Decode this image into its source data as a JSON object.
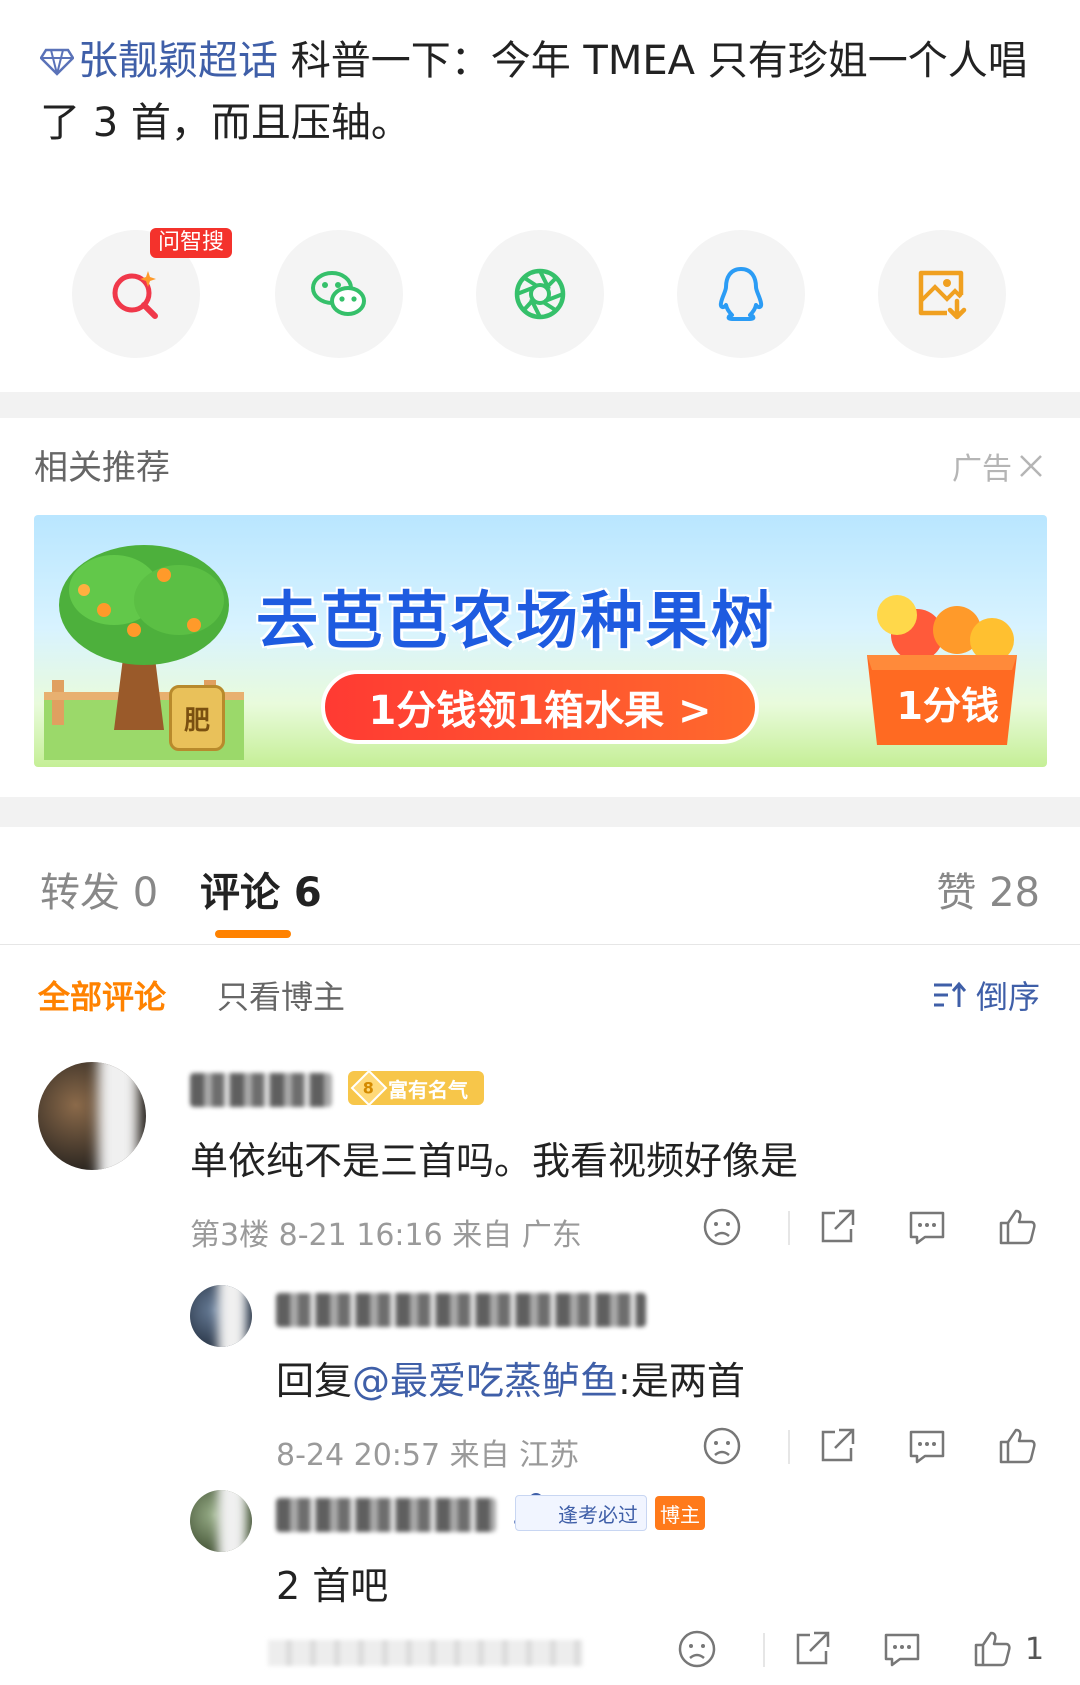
{
  "post": {
    "topic": "张靓颖超话",
    "text": " 科普一下：今年 TMEA 只有珍姐一个人唱了 3 首，而且压轴。"
  },
  "share": {
    "ask_tag": "问智搜",
    "buttons": [
      {
        "name": "ask-search",
        "icon": "search-spark-icon",
        "color": "#f0384a"
      },
      {
        "name": "wechat",
        "icon": "wechat-icon",
        "color": "#35c06a"
      },
      {
        "name": "moments",
        "icon": "aperture-icon",
        "color": "#35c06a"
      },
      {
        "name": "qq",
        "icon": "qq-penguin-icon",
        "color": "#2b9cf5"
      },
      {
        "name": "save-image",
        "icon": "image-download-icon",
        "color": "#f0a020"
      }
    ]
  },
  "recommend": {
    "heading": "相关推荐",
    "ad_label": "广告",
    "banner": {
      "title": "去芭芭农场种果树",
      "cta": "1分钱领1箱水果 >",
      "box_label": "1分钱",
      "fertilizer": "肥"
    }
  },
  "tabs": {
    "forward": "转发 0",
    "comments": "评论 6",
    "likes": "赞 28"
  },
  "filter": {
    "all": "全部评论",
    "op_only": "只看博主",
    "sort": "倒序"
  },
  "comments": [
    {
      "badge": "富有名气",
      "level": "8",
      "text": "单依纯不是三首吗。我看视频好像是",
      "meta": "第3楼  8-21 16:16  来自 广东"
    },
    {
      "reply_prefix": "回复",
      "mention": "@最爱吃蒸鲈鱼",
      "text": ":是两首",
      "meta": "8-24 20:57  来自 江苏"
    },
    {
      "badge_exam": "逢考必过",
      "badge_host": "博主",
      "text": "2 首吧",
      "likes": "1"
    }
  ],
  "colors": {
    "accent_orange": "#ff8200",
    "link_blue": "#3f5fa8"
  }
}
